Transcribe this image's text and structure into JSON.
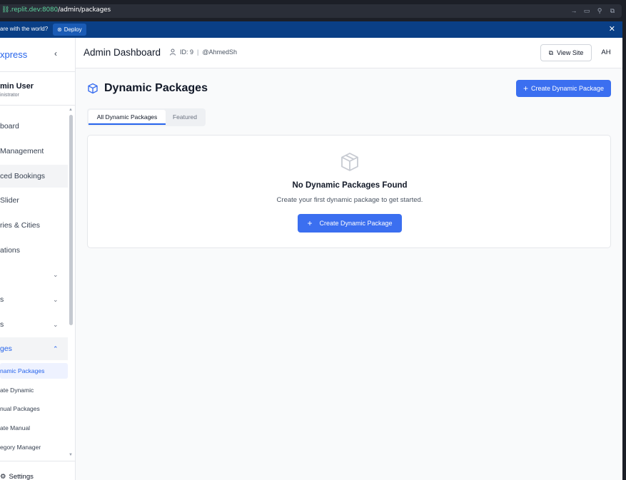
{
  "browser": {
    "url_host": ".replit.dev:8080",
    "url_path": "/admin/packages"
  },
  "banner": {
    "text": "are with the world?",
    "deploy_label": "Deploy"
  },
  "sidebar": {
    "brand": "xpress",
    "user_name": "min User",
    "user_role": "inistrator",
    "items": [
      {
        "label": "board"
      },
      {
        "label": "Management"
      },
      {
        "label": "ced Bookings"
      },
      {
        "label": "Slider"
      },
      {
        "label": "ries & Cities"
      },
      {
        "label": "ations"
      },
      {
        "label": ""
      },
      {
        "label": "s"
      },
      {
        "label": "s"
      },
      {
        "label": "ges"
      }
    ],
    "sub_items": [
      {
        "label": "namic Packages"
      },
      {
        "label": "ate Dynamic"
      },
      {
        "label": "nual Packages"
      },
      {
        "label": "ate Manual"
      },
      {
        "label": "egory Manager"
      }
    ],
    "settings_label": "Settings"
  },
  "header": {
    "title": "Admin Dashboard",
    "user_id": "ID: 9",
    "username": "@AhmedSh",
    "view_site_label": "View Site",
    "avatar_initials": "AH"
  },
  "main": {
    "page_title": "Dynamic Packages",
    "create_button_label": "Create Dynamic Package",
    "tabs": [
      {
        "label": "All Dynamic Packages"
      },
      {
        "label": "Featured"
      }
    ],
    "empty_title": "No Dynamic Packages Found",
    "empty_subtitle": "Create your first dynamic package to get started.",
    "empty_button_label": "Create Dynamic Package"
  },
  "colors": {
    "accent": "#3b6ff0",
    "banner": "#0a3f86"
  }
}
